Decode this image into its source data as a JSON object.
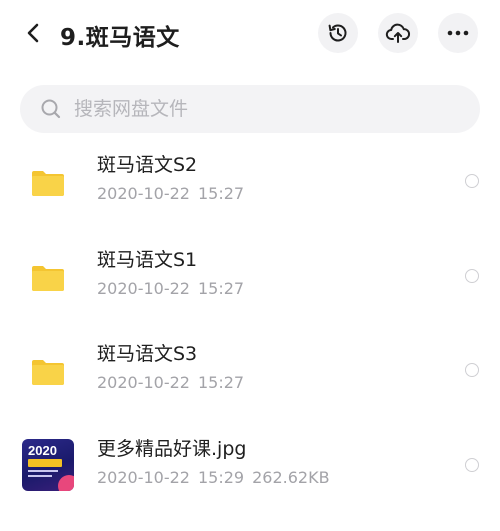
{
  "header": {
    "title": "9.斑马语文"
  },
  "search": {
    "placeholder": "搜索网盘文件"
  },
  "files": [
    {
      "type": "folder",
      "name": "斑马语文S2",
      "date": "2020-10-22",
      "time": "15:27",
      "size": ""
    },
    {
      "type": "folder",
      "name": "斑马语文S1",
      "date": "2020-10-22",
      "time": "15:27",
      "size": ""
    },
    {
      "type": "folder",
      "name": "斑马语文S3",
      "date": "2020-10-22",
      "time": "15:27",
      "size": ""
    },
    {
      "type": "image",
      "name": "更多精品好课.jpg",
      "date": "2020-10-22",
      "time": "15:29",
      "size": "262.62KB",
      "thumb_text": "2020"
    }
  ],
  "colors": {
    "folder": "#f9d348",
    "folder_tab": "#f4c531",
    "icon": "#1e1e1e"
  }
}
